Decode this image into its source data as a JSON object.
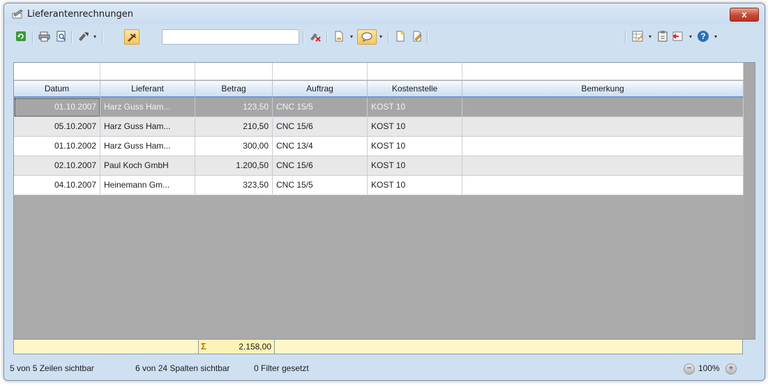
{
  "window": {
    "title": "Lieferantenrechnungen",
    "close_label": "x"
  },
  "toolbar": {
    "icons": [
      "refresh-icon",
      "print-icon",
      "print-preview-icon",
      "tools-icon",
      "filter-icon",
      "clear-filter-icon",
      "export-icon",
      "comment-icon",
      "new-record-icon",
      "edit-record-icon",
      "layout-icon",
      "clipboard-icon",
      "exit-icon",
      "help-icon"
    ],
    "search_value": ""
  },
  "table": {
    "columns": [
      "Datum",
      "Lieferant",
      "Betrag",
      "Auftrag",
      "Kostenstelle",
      "Bemerkung"
    ],
    "rows": [
      [
        "01.10.2007",
        "Harz Guss Ham...",
        "123,50",
        "CNC 15/5",
        "KOST 10",
        ""
      ],
      [
        "05.10.2007",
        "Harz Guss Ham...",
        "210,50",
        "CNC 15/6",
        "KOST 10",
        ""
      ],
      [
        "01.10.2002",
        "Harz Guss Ham...",
        "300,00",
        "CNC 13/4",
        "KOST 10",
        ""
      ],
      [
        "02.10.2007",
        "Paul Koch GmbH",
        "1.200,50",
        "CNC 15/6",
        "KOST 10",
        ""
      ],
      [
        "04.10.2007",
        "Heinemann Gm...",
        "323,50",
        "CNC 15/5",
        "KOST 10",
        ""
      ]
    ],
    "selected_row": 0
  },
  "summary": {
    "sigma": "Σ",
    "total": "2.158,00"
  },
  "status": {
    "rows_visible": "5 von 5 Zeilen sichtbar",
    "cols_visible": "6 von 24 Spalten sichtbar",
    "filters": "0 Filter gesetzt",
    "zoom": "100%"
  },
  "colors": {
    "window_bg": "#cfe0f1",
    "selected_row": "#a6a6a6",
    "sum_row": "#fdf6c8",
    "accent": "#6f9bd1"
  }
}
